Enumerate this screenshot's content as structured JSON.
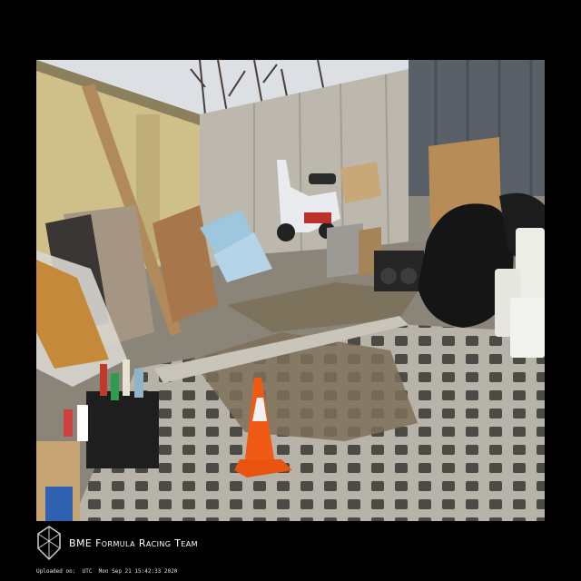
{
  "footer": {
    "team_name": "BME Formula Racing Team",
    "upload_label": "Uploaded on:",
    "upload_timestamp": "UTC  Mon Sep 21 15:42:33 2020"
  },
  "colors": {
    "frame": "#000000",
    "cone": "#f05a14",
    "text": "#ffffff"
  }
}
